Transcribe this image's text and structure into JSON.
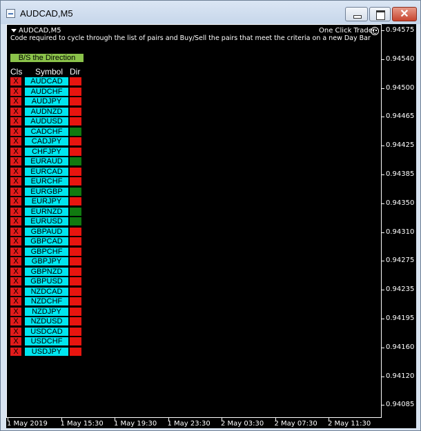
{
  "window": {
    "title": "AUDCAD,M5"
  },
  "chart": {
    "symbol_label": "AUDCAD,M5",
    "subtitle": "Code required to cycle through the list of pairs and Buy/Sell the pairs that meet the criteria on a new Day Bar",
    "expert_name": "One Click Trader",
    "bs_button_label": "B/S the Direction",
    "headers": {
      "cls": "Cls",
      "symbol": "Symbol",
      "dir": "Dir"
    },
    "y_ticks": [
      "0.94575",
      "0.94540",
      "0.94500",
      "0.94465",
      "0.94425",
      "0.94385",
      "0.94350",
      "0.94310",
      "0.94275",
      "0.94235",
      "0.94195",
      "0.94160",
      "0.94120",
      "0.94085"
    ],
    "x_ticks": [
      "1 May 2019",
      "1 May 15:30",
      "1 May 19:30",
      "1 May 23:30",
      "2 May 03:30",
      "2 May 07:30",
      "2 May 11:30"
    ]
  },
  "pairs": [
    {
      "cls": "X",
      "symbol": "AUDCAD",
      "dir": "sell"
    },
    {
      "cls": "X",
      "symbol": "AUDCHF",
      "dir": "sell"
    },
    {
      "cls": "X",
      "symbol": "AUDJPY",
      "dir": "sell"
    },
    {
      "cls": "X",
      "symbol": "AUDNZD",
      "dir": "sell"
    },
    {
      "cls": "X",
      "symbol": "AUDUSD",
      "dir": "sell"
    },
    {
      "cls": "X",
      "symbol": "CADCHF",
      "dir": "buy"
    },
    {
      "cls": "X",
      "symbol": "CADJPY",
      "dir": "sell"
    },
    {
      "cls": "X",
      "symbol": "CHFJPY",
      "dir": "sell"
    },
    {
      "cls": "X",
      "symbol": "EURAUD",
      "dir": "buy"
    },
    {
      "cls": "X",
      "symbol": "EURCAD",
      "dir": "sell"
    },
    {
      "cls": "X",
      "symbol": "EURCHF",
      "dir": "sell"
    },
    {
      "cls": "X",
      "symbol": "EURGBP",
      "dir": "buy"
    },
    {
      "cls": "X",
      "symbol": "EURJPY",
      "dir": "sell"
    },
    {
      "cls": "X",
      "symbol": "EURNZD",
      "dir": "buy"
    },
    {
      "cls": "X",
      "symbol": "EURUSD",
      "dir": "buy"
    },
    {
      "cls": "X",
      "symbol": "GBPAUD",
      "dir": "sell"
    },
    {
      "cls": "X",
      "symbol": "GBPCAD",
      "dir": "sell"
    },
    {
      "cls": "X",
      "symbol": "GBPCHF",
      "dir": "sell"
    },
    {
      "cls": "X",
      "symbol": "GBPJPY",
      "dir": "sell"
    },
    {
      "cls": "X",
      "symbol": "GBPNZD",
      "dir": "sell"
    },
    {
      "cls": "X",
      "symbol": "GBPUSD",
      "dir": "sell"
    },
    {
      "cls": "X",
      "symbol": "NZDCAD",
      "dir": "sell"
    },
    {
      "cls": "X",
      "symbol": "NZDCHF",
      "dir": "sell"
    },
    {
      "cls": "X",
      "symbol": "NZDJPY",
      "dir": "sell"
    },
    {
      "cls": "X",
      "symbol": "NZDUSD",
      "dir": "sell"
    },
    {
      "cls": "X",
      "symbol": "USDCAD",
      "dir": "sell"
    },
    {
      "cls": "X",
      "symbol": "USDCHF",
      "dir": "sell"
    },
    {
      "cls": "X",
      "symbol": "USDJPY",
      "dir": "sell"
    }
  ],
  "colors": {
    "close_button": "#e21b1b",
    "symbol_button": "#00e5ef",
    "dir_sell": "#e8150f",
    "dir_buy": "#107a10",
    "bs_button": "#8bc34a",
    "chart_bg": "#000000"
  }
}
